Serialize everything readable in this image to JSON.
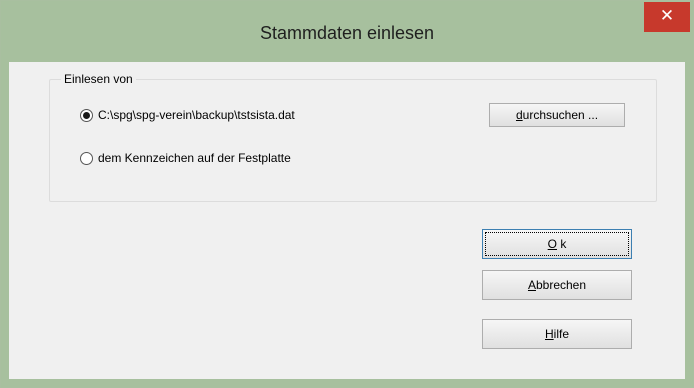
{
  "window": {
    "title": "Stammdaten einlesen",
    "close_symbol": "✕"
  },
  "group": {
    "label": "Einlesen von",
    "options": [
      {
        "label": "C:\\spg\\spg-verein\\backup\\tstsista.dat",
        "checked": true
      },
      {
        "label": "dem Kennzeichen auf der Festplatte",
        "checked": false
      }
    ],
    "browse_button": {
      "mnemonic": "d",
      "rest": "urchsuchen ..."
    }
  },
  "buttons": {
    "ok": {
      "mnemonic": "O",
      "rest": " k"
    },
    "cancel": {
      "mnemonic": "A",
      "rest": "bbrechen"
    },
    "help": {
      "mnemonic": "H",
      "rest": "ilfe"
    }
  }
}
